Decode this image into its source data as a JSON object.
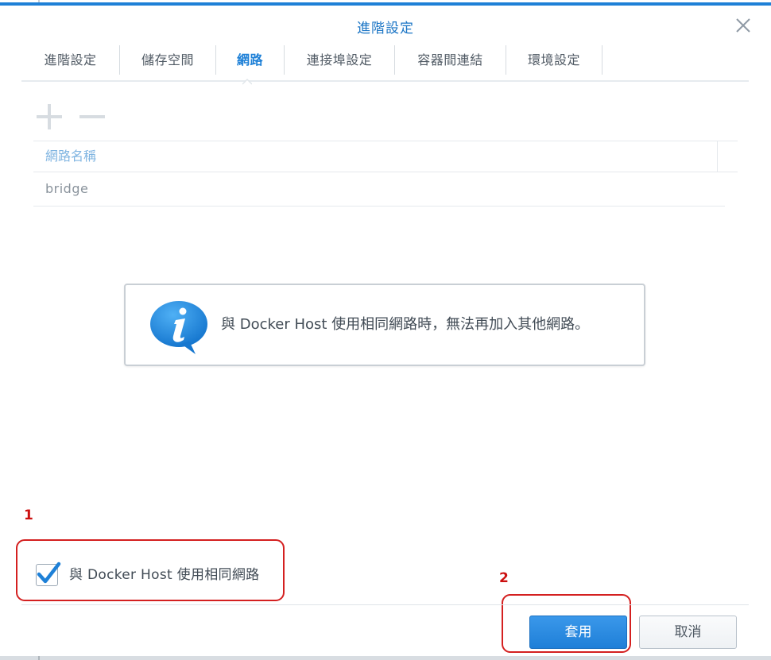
{
  "window": {
    "title": "進階設定"
  },
  "tabs": [
    {
      "label": "進階設定",
      "active": false
    },
    {
      "label": "儲存空間",
      "active": false
    },
    {
      "label": "網路",
      "active": true
    },
    {
      "label": "連接埠設定",
      "active": false
    },
    {
      "label": "容器間連結",
      "active": false
    },
    {
      "label": "環境設定",
      "active": false
    }
  ],
  "toolbar": {
    "add_icon": "plus-icon",
    "remove_icon": "minus-icon"
  },
  "grid": {
    "columns": [
      "網路名稱"
    ],
    "rows": [
      [
        "bridge"
      ]
    ]
  },
  "info": {
    "icon": "info-icon",
    "message": "與 Docker Host 使用相同網路時，無法再加入其他網路。"
  },
  "option": {
    "label": "與 Docker Host 使用相同網路",
    "checked": true
  },
  "annotations": {
    "first": "1",
    "second": "2"
  },
  "buttons": {
    "apply": "套用",
    "cancel": "取消"
  },
  "colors": {
    "accent": "#1e80d7",
    "annotation": "#d42020",
    "header_text": "#7fb4e1"
  }
}
